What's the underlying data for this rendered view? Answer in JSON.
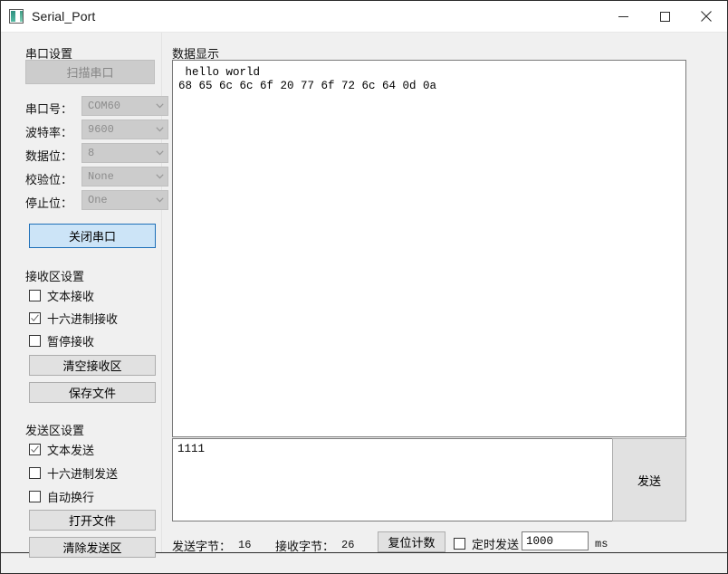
{
  "window": {
    "title": "Serial_Port",
    "icon": "app-icon",
    "controls": {
      "minimize": "minimize-icon",
      "maximize": "maximize-icon",
      "close": "close-icon"
    }
  },
  "serial_settings": {
    "group_label": "串口设置",
    "scan_button": "扫描串口",
    "scan_button_enabled": false,
    "fields": [
      {
        "label": "串口号：",
        "value": "COM60",
        "enabled": false
      },
      {
        "label": "波特率：",
        "value": "9600",
        "enabled": false
      },
      {
        "label": "数据位：",
        "value": "8",
        "enabled": false
      },
      {
        "label": "校验位：",
        "value": "None",
        "enabled": false
      },
      {
        "label": "停止位：",
        "value": "One",
        "enabled": false
      }
    ],
    "toggle_button": "关闭串口"
  },
  "receive_settings": {
    "group_label": "接收区设置",
    "checkboxes": [
      {
        "label": "文本接收",
        "checked": false
      },
      {
        "label": "十六进制接收",
        "checked": true
      },
      {
        "label": "暂停接收",
        "checked": false
      }
    ],
    "clear_button": "清空接收区",
    "save_button": "保存文件"
  },
  "send_settings": {
    "group_label": "发送区设置",
    "checkboxes": [
      {
        "label": "文本发送",
        "checked": true
      },
      {
        "label": "十六进制发送",
        "checked": false
      },
      {
        "label": "自动换行",
        "checked": false
      }
    ],
    "open_file_button": "打开文件",
    "clear_send_button": "清除发送区"
  },
  "data_display": {
    "group_label": "数据显示",
    "content": " hello world\n68 65 6c 6c 6f 20 77 6f 72 6c 64 0d 0a"
  },
  "send_box": {
    "content": "1111",
    "send_button": "发送"
  },
  "status": {
    "sent_label": "发送字节：",
    "sent_value": "16",
    "recv_label": "接收字节：",
    "recv_value": "26",
    "reset_button": "复位计数",
    "timer_checkbox": {
      "label": "定时发送",
      "checked": false
    },
    "interval_value": "1000",
    "interval_unit": "ms"
  },
  "colors": {
    "window_bg": "#f0f0f0",
    "accent": "#cce4f7",
    "accent_border": "#1d6fb8",
    "disabled_bg": "#cccccc",
    "disabled_text": "#868686"
  }
}
